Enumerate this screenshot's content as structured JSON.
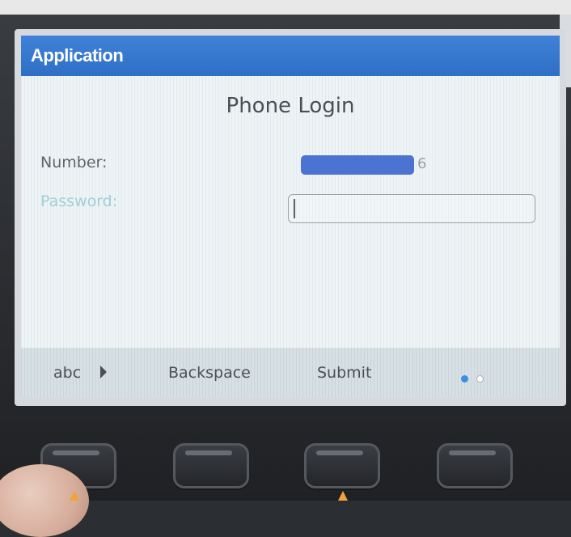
{
  "app": {
    "title": "Application"
  },
  "login": {
    "title": "Phone Login",
    "number_label": "Number:",
    "number_suffix": "6",
    "password_label": "Password:"
  },
  "softkeys": {
    "mode_label": "abc",
    "backspace_label": "Backspace",
    "submit_label": "Submit",
    "page_index": 1,
    "page_count": 2
  },
  "colors": {
    "titlebar": "#2f6fc6",
    "accent": "#3a8fe0",
    "redaction": "#4b73d1"
  },
  "icons": {
    "mode_arrow": "triangle-right-icon",
    "page_dot_active": "dot-filled-icon",
    "page_dot_inactive": "dot-hollow-icon"
  }
}
